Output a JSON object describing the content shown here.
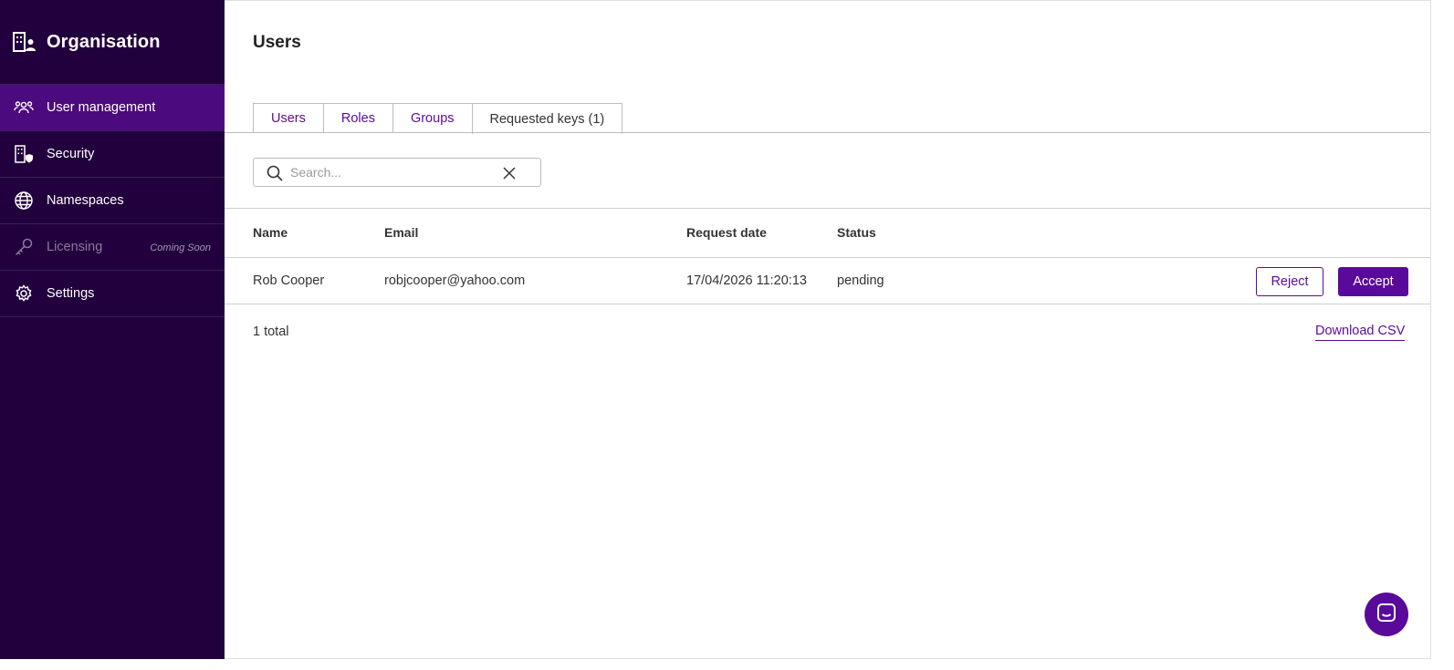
{
  "sidebar": {
    "title": "Organisation",
    "title_icon": "organisation-icon",
    "items": [
      {
        "label": "User management",
        "icon": "users-icon",
        "active": true
      },
      {
        "label": "Security",
        "icon": "building-shield-icon"
      },
      {
        "label": "Namespaces",
        "icon": "globe-icon"
      },
      {
        "label": "Licensing",
        "icon": "key-icon",
        "disabled": true,
        "badge": "Coming Soon"
      },
      {
        "label": "Settings",
        "icon": "gear-icon"
      }
    ]
  },
  "main": {
    "title": "Users",
    "tabs": [
      {
        "label": "Users"
      },
      {
        "label": "Roles"
      },
      {
        "label": "Groups"
      },
      {
        "label": "Requested keys (1)",
        "active": true
      }
    ],
    "search": {
      "placeholder": "Search...",
      "value": ""
    },
    "table": {
      "columns": [
        "Name",
        "Email",
        "Request date",
        "Status"
      ],
      "rows": [
        {
          "name": "Rob Cooper",
          "email": "robjcooper@yahoo.com",
          "request_date": "17/04/2026 11:20:13",
          "status": "pending",
          "reject_label": "Reject",
          "accept_label": "Accept"
        }
      ]
    },
    "total": "1 total",
    "download_label": "Download CSV"
  },
  "colors": {
    "sidebar_bg": "#22003d",
    "sidebar_active": "#4b0a7e",
    "accent": "#5a0a9b"
  }
}
